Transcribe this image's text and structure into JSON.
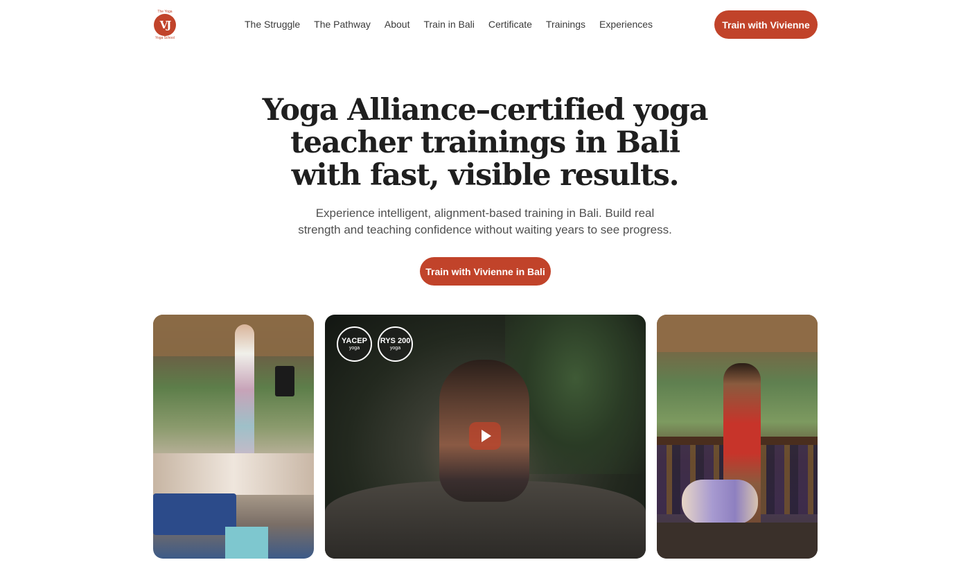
{
  "header": {
    "logo": {
      "monogram": "VJ",
      "text_top": "The Yoga",
      "text_bottom": "Yoga School"
    },
    "nav_items": [
      {
        "label": "The Struggle"
      },
      {
        "label": "The Pathway"
      },
      {
        "label": "About"
      },
      {
        "label": "Train in Bali"
      },
      {
        "label": "Certificate"
      },
      {
        "label": "Trainings"
      },
      {
        "label": "Experiences"
      }
    ],
    "cta_label": "Train with Vivienne"
  },
  "hero": {
    "title_lines": [
      "Yoga Alliance–certified yoga",
      "teacher trainings in Bali",
      "with fast, visible results."
    ],
    "subtitle_lines": [
      "Experience intelligent, alignment-based training in Bali. Build real",
      "strength and teaching confidence without waiting years to see progress."
    ],
    "cta_label": "Train with Vivienne in Bali"
  },
  "gallery": {
    "badges": [
      {
        "main": "YACEP",
        "sub": "yoga"
      },
      {
        "main": "RYS 200",
        "sub": "yoga"
      }
    ],
    "play_icon": "play-icon"
  },
  "colors": {
    "accent": "#c1432a",
    "text": "#1f1f1f"
  }
}
